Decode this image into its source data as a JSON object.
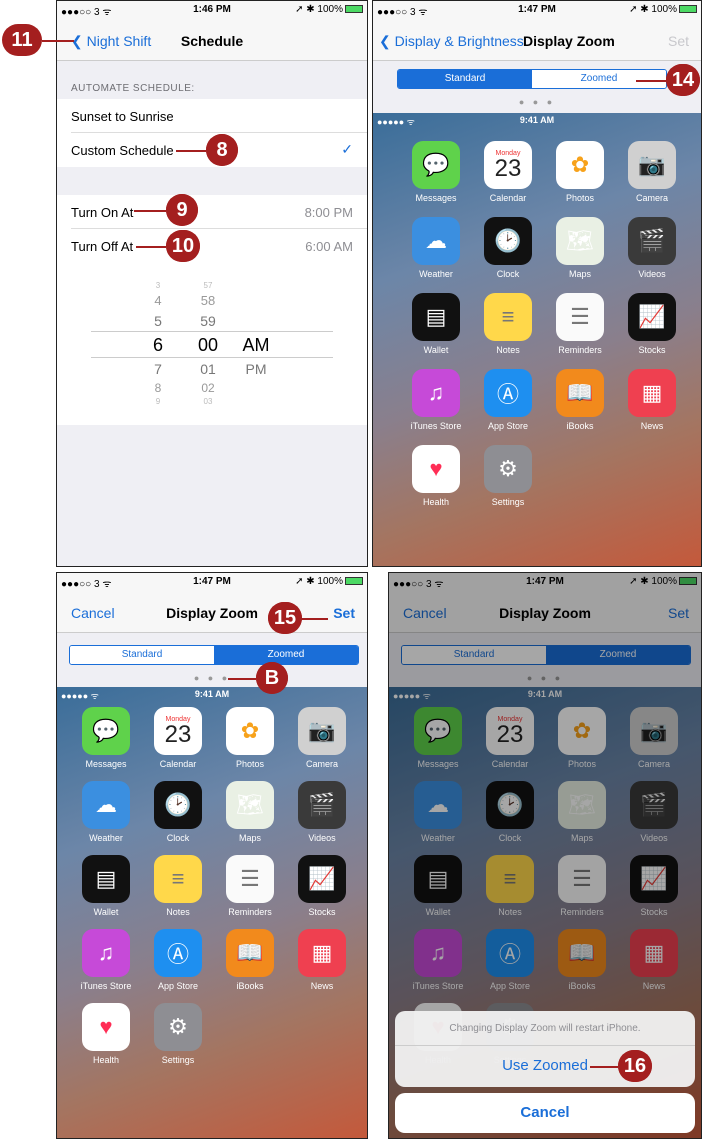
{
  "status1": {
    "carrier": "●●●○○ 3 ᯤ",
    "time": "1:46 PM",
    "right": "➚ ✱ 100%"
  },
  "status2": {
    "carrier": "●●●○○ 3 ᯤ",
    "time": "1:47 PM",
    "right": "➚ ✱ 100%"
  },
  "screen1": {
    "back": "Night Shift",
    "title": "Schedule",
    "section": "AUTOMATE SCHEDULE:",
    "opt1": "Sunset to Sunrise",
    "opt2": "Custom Schedule",
    "check": "✓",
    "on_label": "Turn On At",
    "on_value": "8:00 PM",
    "off_label": "Turn Off At",
    "off_value": "6:00 AM",
    "hours": [
      "3",
      "4",
      "5",
      "6",
      "7",
      "8",
      "9"
    ],
    "minutes": [
      "57",
      "58",
      "59",
      "00",
      "01",
      "02",
      "03"
    ],
    "ampm": [
      "AM",
      "PM"
    ]
  },
  "screen2": {
    "back": "Display & Brightness",
    "title": "Display Zoom",
    "right": "Set",
    "seg_standard": "Standard",
    "seg_zoomed": "Zoomed",
    "dots": "● ● ●"
  },
  "screen3": {
    "left": "Cancel",
    "title": "Display Zoom",
    "right": "Set",
    "seg_standard": "Standard",
    "seg_zoomed": "Zoomed",
    "dots": "● ● ●"
  },
  "screen4": {
    "left": "Cancel",
    "title": "Display Zoom",
    "right": "Set",
    "seg_standard": "Standard",
    "seg_zoomed": "Zoomed",
    "dots": "● ● ●",
    "alert_msg": "Changing Display Zoom will restart iPhone.",
    "use_zoomed": "Use Zoomed",
    "cancel": "Cancel"
  },
  "home": {
    "carrier": "●●●●● ᯤ",
    "time": "9:41 AM",
    "calendar_day": "Monday",
    "calendar_date": "23",
    "apps": [
      "Messages",
      "Calendar",
      "Photos",
      "Camera",
      "Weather",
      "Clock",
      "Maps",
      "Videos",
      "Wallet",
      "Notes",
      "Reminders",
      "Stocks",
      "iTunes Store",
      "App Store",
      "iBooks",
      "News",
      "Health",
      "Settings"
    ]
  },
  "callouts": {
    "c8": "8",
    "c9": "9",
    "c10": "10",
    "c11": "11",
    "c14": "14",
    "c15": "15",
    "cB": "B",
    "c16": "16"
  },
  "colors": {
    "ios_blue": "#1a6ed8",
    "callout": "#a41f1f"
  }
}
